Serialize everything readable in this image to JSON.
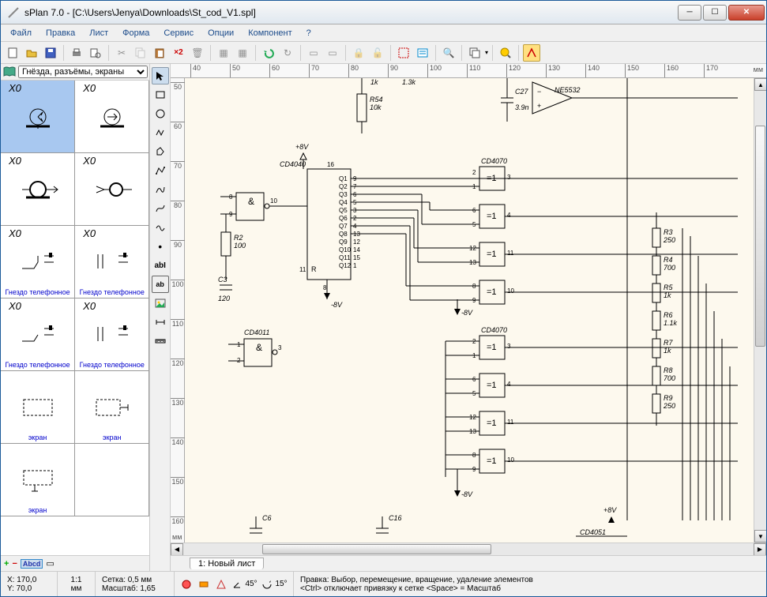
{
  "title": "sPlan 7.0 - [C:\\Users\\Jenya\\Downloads\\St_cod_V1.spl]",
  "menu": [
    "Файл",
    "Правка",
    "Лист",
    "Форма",
    "Сервис",
    "Опции",
    "Компонент",
    "?"
  ],
  "library_dropdown": "Гнёзда, разъёмы, экраны",
  "library_cells": [
    {
      "top": "X0",
      "bot": ""
    },
    {
      "top": "X0",
      "bot": ""
    },
    {
      "top": "X0",
      "bot": ""
    },
    {
      "top": "X0",
      "bot": ""
    },
    {
      "top": "X0",
      "bot": "Гнездо телефонное"
    },
    {
      "top": "X0",
      "bot": "Гнездо телефонное"
    },
    {
      "top": "X0",
      "bot": "Гнездо телефонное"
    },
    {
      "top": "X0",
      "bot": "Гнездо телефонное"
    },
    {
      "top": "",
      "bot": "экран"
    },
    {
      "top": "",
      "bot": "экран"
    },
    {
      "top": "",
      "bot": "экран"
    },
    {
      "top": "",
      "bot": ""
    }
  ],
  "ruler_h": {
    "ticks": [
      "40",
      "50",
      "60",
      "70",
      "80",
      "90",
      "100",
      "110",
      "120",
      "130",
      "140",
      "150",
      "160",
      "170"
    ],
    "unit": "мм"
  },
  "ruler_v": {
    "ticks": [
      "50",
      "60",
      "70",
      "80",
      "90",
      "100",
      "110",
      "120",
      "130",
      "140",
      "150",
      "160"
    ],
    "unit": "мм"
  },
  "sheet_tab": "1: Новый лист",
  "status": {
    "coord_x": "X: 170,0",
    "coord_y": "Y: 70,0",
    "scale_ratio": "1:1",
    "scale_unit": "мм",
    "grid": "Сетка: 0,5 мм",
    "zoom": "Масштаб:  1,65",
    "angle1": "45°",
    "angle2": "15°",
    "help1": "Правка: Выбор, перемещение, вращение, удаление элементов",
    "help2": "<Ctrl> отключает привязку к сетке <Space> = Масштаб"
  },
  "schematic": {
    "labels": {
      "r54": "R54",
      "r54_val": "10k",
      "v1k": "1k",
      "v13k": "1.3k",
      "c27": "C27",
      "c27_val": "3.9n",
      "ne5532": "NE5532",
      "plus8v_top": "+8V",
      "cd4040": "CD4040",
      "ic_gate": "&",
      "cd4011": "CD4011",
      "r2": "R2",
      "r2_val": "100",
      "c3": "C3",
      "c3_val": "120",
      "minus8v": "-8V",
      "minus8v_2": "-8V",
      "minus8v_3": "-8V",
      "cd4070_1": "CD4070",
      "cd4070_2": "CD4070",
      "eq1": "=1",
      "r3": "R3",
      "r3_val": "250",
      "r4": "R4",
      "r4_val": "700",
      "r5": "R5",
      "r5_val": "1k",
      "r6": "R6",
      "r6_val": "1.1k",
      "r7": "R7",
      "r7_val": "1k",
      "r8": "R8",
      "r8_val": "700",
      "r9": "R9",
      "r9_val": "250",
      "c6": "C6",
      "c16": "C16",
      "plus8v_bot": "+8V",
      "cd4051": "CD4051",
      "q_pins": [
        "Q1",
        "Q2",
        "Q3",
        "Q4",
        "Q5",
        "Q6",
        "Q7",
        "Q8",
        "Q9",
        "Q10",
        "Q11",
        "Q12"
      ],
      "pin_nums_left": [
        "8",
        "9",
        "10",
        "16",
        "11",
        "8",
        "1",
        "2",
        "3",
        "9",
        "7",
        "6",
        "5",
        "3",
        "2",
        "4",
        "13",
        "12",
        "14",
        "15",
        "1"
      ],
      "gate_pins": [
        "2",
        "1",
        "3",
        "6",
        "5",
        "4",
        "13",
        "12",
        "11",
        "8",
        "9",
        "10"
      ]
    }
  }
}
